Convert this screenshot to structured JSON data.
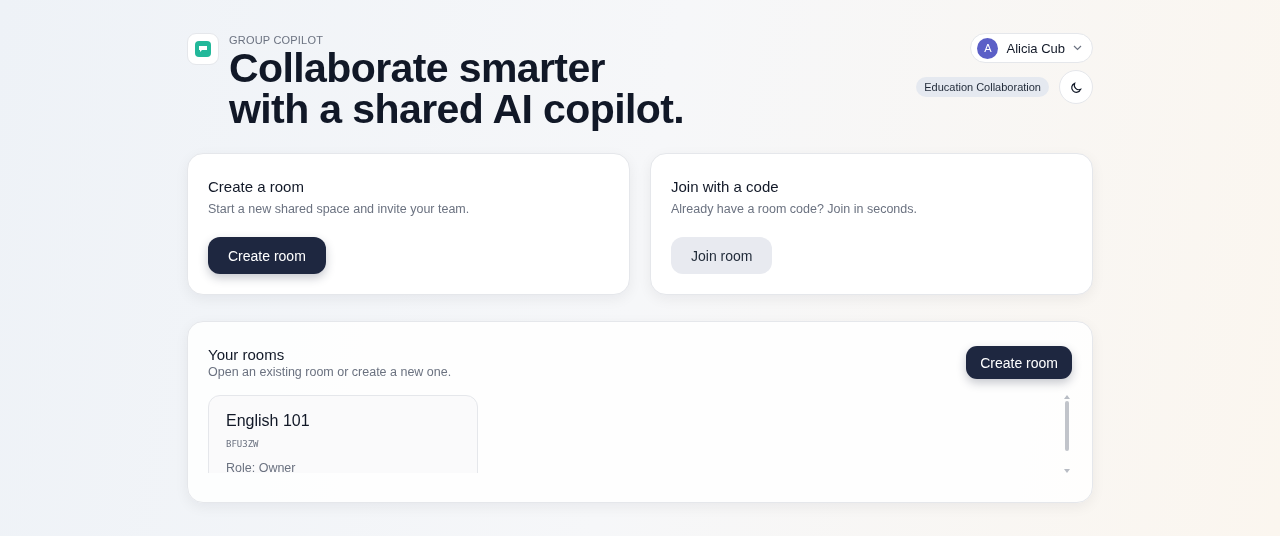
{
  "brand": {
    "eyebrow": "GROUP COPILOT",
    "headline_lines": [
      "Collaborate smarter",
      "with a shared AI copilot."
    ]
  },
  "user": {
    "initial": "A",
    "name": "Alicia Cub"
  },
  "workspace_tag": "Education Collaboration",
  "actions": [
    {
      "title": "Create a room",
      "description": "Start a new shared space and invite your team.",
      "button": "Create room",
      "kind": "primary"
    },
    {
      "title": "Join with a code",
      "description": "Already have a room code? Join in seconds.",
      "button": "Join room",
      "kind": "secondary"
    }
  ],
  "rooms_panel": {
    "title": "Your rooms",
    "subtitle": "Open an existing room or create a new one.",
    "button": "Create room",
    "rooms": [
      {
        "name": "English 101",
        "code": "BFU3ZW",
        "role": "Role: Owner"
      }
    ]
  }
}
